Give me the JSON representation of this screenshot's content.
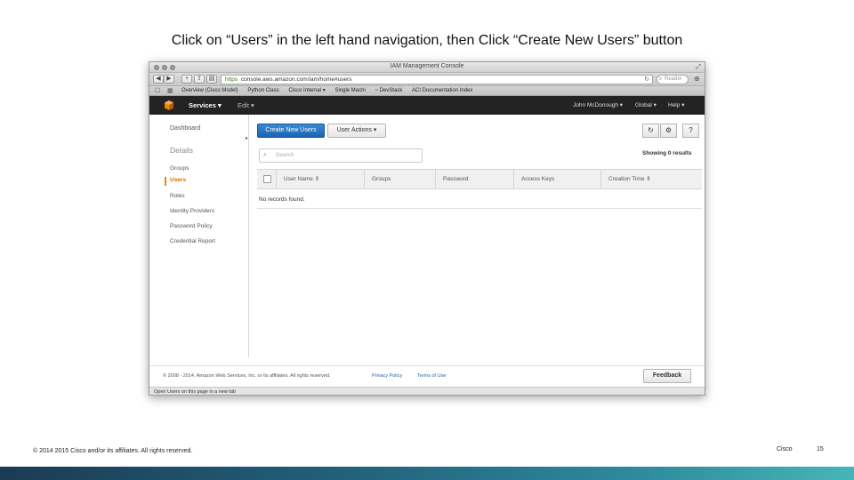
{
  "slide": {
    "title": "Click on “Users” in the left hand navigation, then Click “Create New Users” button",
    "copyright": "© 2014 2015  Cisco and/or its affiliates. All rights reserved.",
    "company": "Cisco",
    "page_number": "15"
  },
  "browser": {
    "window_title": "IAM Management Console",
    "url_prefix": "https",
    "url": "console.aws.amazon.com/iam/home#users",
    "search_placeholder": "Reader",
    "bookmarks": [
      "Overview (Cisco Model)",
      "Python Class",
      "Cisco Internal ▾",
      "Single Machi",
      "~ DevStack",
      "ACI Documentation Index"
    ],
    "status_text": "Open Users on this page in a new tab"
  },
  "aws_nav": {
    "services": "Services",
    "edit": "Edit",
    "user": "John McDonough",
    "region": "Global",
    "help": "Help"
  },
  "sidebar": {
    "dashboard": "Dashboard",
    "heading": "Details",
    "items": [
      "Groups",
      "Users",
      "Roles",
      "Identity Providers",
      "Password Policy",
      "Credential Report"
    ]
  },
  "main": {
    "create_button": "Create New Users",
    "actions_button": "User Actions",
    "search_placeholder": "Search",
    "showing": "Showing 0 results",
    "columns": [
      "User Name",
      "Groups",
      "Password",
      "Access Keys",
      "Creation Time"
    ],
    "empty_message": "No records found."
  },
  "footer": {
    "copyright": "© 2008 - 2014, Amazon Web Services, Inc. or its affiliates. All rights reserved.",
    "privacy": "Privacy Policy",
    "terms": "Terms of Use",
    "feedback": "Feedback"
  },
  "colors": {
    "aws_nav_bg": "#232323",
    "primary_button": "#1c63b3",
    "active_nav": "#d96b00",
    "slide_band": "#2e8b9c"
  },
  "icons": [
    "refresh-icon",
    "settings-gear-icon",
    "help-icon",
    "search-icon",
    "aws-logo-icon"
  ]
}
